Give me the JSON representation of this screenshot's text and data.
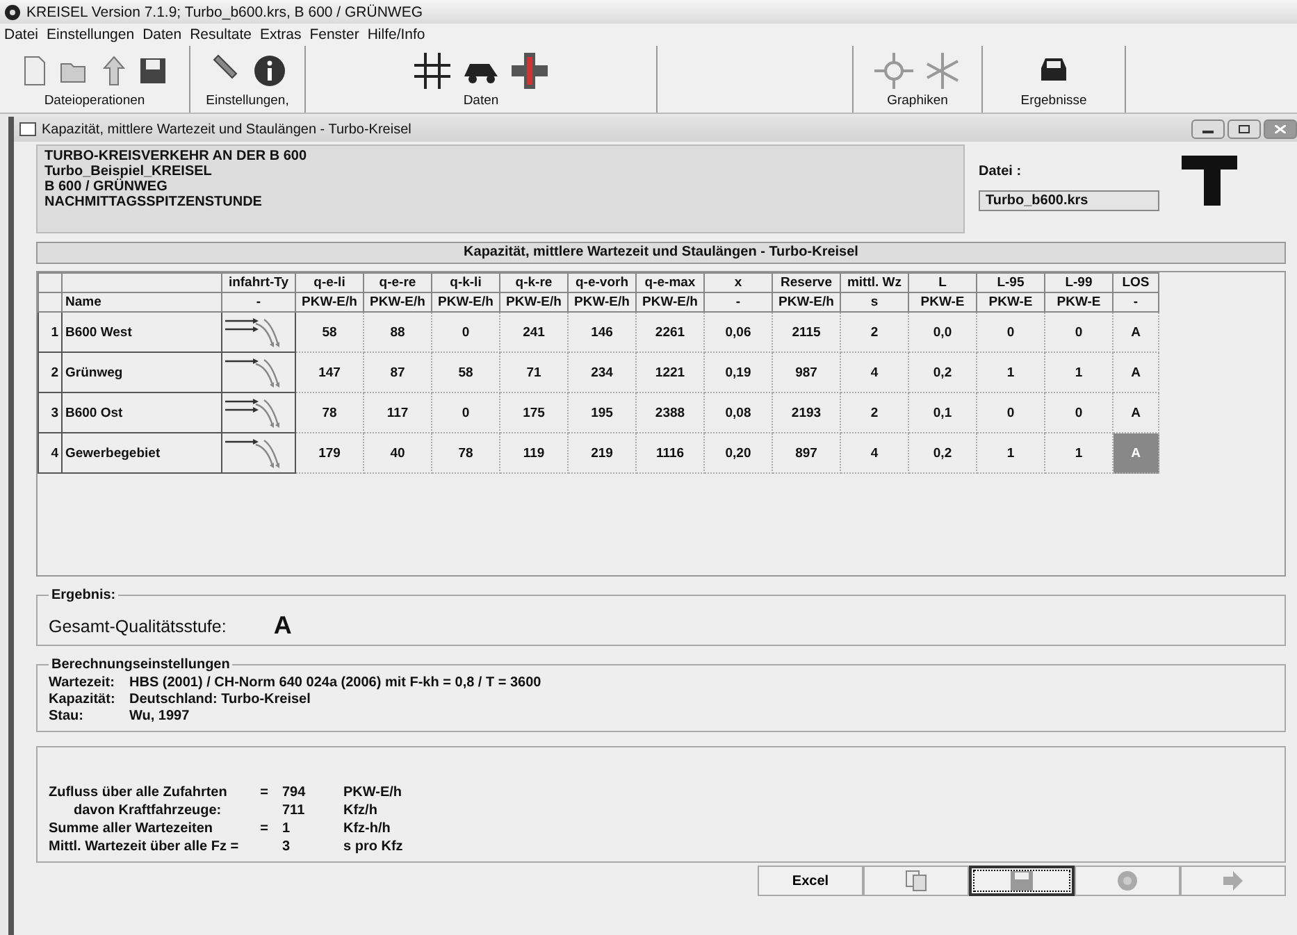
{
  "window": {
    "title": "KREISEL Version 7.1.9;  Turbo_b600.krs,  B 600 / GRÜNWEG"
  },
  "menu": [
    "Datei",
    "Einstellungen",
    "Daten",
    "Resultate",
    "Extras",
    "Fenster",
    "Hilfe/Info"
  ],
  "toolbar": [
    {
      "label": "Dateioperationen"
    },
    {
      "label": "Einstellungen,"
    },
    {
      "label": "Daten"
    },
    {
      "label": "Graphiken"
    },
    {
      "label": "Ergebnisse"
    }
  ],
  "subwindow": {
    "title": "Kapazität, mittlere Wartezeit und Staulängen  -  Turbo-Kreisel"
  },
  "project": [
    "TURBO-KREISVERKEHR AN DER B 600",
    "Turbo_Beispiel_KREISEL",
    "B 600 / GRÜNWEG",
    "NACHMITTAGSSPITZENSTUNDE"
  ],
  "file": {
    "label": "Datei :",
    "value": "Turbo_b600.krs"
  },
  "table": {
    "title": "Kapazität, mittlere Wartezeit und Staulängen   -   Turbo-Kreisel",
    "columns": [
      {
        "header": "infahrt-Ty",
        "unit": "-"
      },
      {
        "header": "q-e-li",
        "unit": "PKW-E/h"
      },
      {
        "header": "q-e-re",
        "unit": "PKW-E/h"
      },
      {
        "header": "q-k-li",
        "unit": "PKW-E/h"
      },
      {
        "header": "q-k-re",
        "unit": "PKW-E/h"
      },
      {
        "header": "q-e-vorh",
        "unit": "PKW-E/h"
      },
      {
        "header": "q-e-max",
        "unit": "PKW-E/h"
      },
      {
        "header": "x",
        "unit": "-"
      },
      {
        "header": "Reserve",
        "unit": "PKW-E/h"
      },
      {
        "header": "mittl. Wz",
        "unit": "s"
      },
      {
        "header": "L",
        "unit": "PKW-E"
      },
      {
        "header": "L-95",
        "unit": "PKW-E"
      },
      {
        "header": "L-99",
        "unit": "PKW-E"
      },
      {
        "header": "LOS",
        "unit": "-"
      }
    ],
    "name_header": "Name",
    "rows": [
      {
        "index": "1",
        "name": "B600 West",
        "kind": "double",
        "values": [
          "58",
          "88",
          "0",
          "241",
          "146",
          "2261",
          "0,06",
          "2115",
          "2",
          "0,0",
          "0",
          "0"
        ],
        "los": "A",
        "selected": false
      },
      {
        "index": "2",
        "name": "Grünweg",
        "kind": "single",
        "values": [
          "147",
          "87",
          "58",
          "71",
          "234",
          "1221",
          "0,19",
          "987",
          "4",
          "0,2",
          "1",
          "1"
        ],
        "los": "A",
        "selected": false
      },
      {
        "index": "3",
        "name": "B600 Ost",
        "kind": "double",
        "values": [
          "78",
          "117",
          "0",
          "175",
          "195",
          "2388",
          "0,08",
          "2193",
          "2",
          "0,1",
          "0",
          "0"
        ],
        "los": "A",
        "selected": false
      },
      {
        "index": "4",
        "name": "Gewerbegebiet",
        "kind": "single",
        "values": [
          "179",
          "40",
          "78",
          "119",
          "219",
          "1116",
          "0,20",
          "897",
          "4",
          "0,2",
          "1",
          "1"
        ],
        "los": "A",
        "selected": true
      }
    ]
  },
  "result": {
    "legend": "Ergebnis:",
    "label": "Gesamt-Qualitätsstufe:",
    "value": "A"
  },
  "settings": {
    "legend": "Berechnungseinstellungen",
    "lines": [
      {
        "label": "Wartezeit:",
        "value": "HBS (2001) / CH-Norm 640 024a (2006) mit F-kh = 0,8 / T = 3600"
      },
      {
        "label": "Kapazität:",
        "value": "Deutschland: Turbo-Kreisel"
      },
      {
        "label": "Stau:",
        "value": "Wu, 1997"
      }
    ]
  },
  "summary": [
    {
      "label": "Zufluss über alle Zufahrten",
      "sign": "=",
      "value": "794",
      "unit": "PKW-E/h",
      "kind": "main"
    },
    {
      "label": "davon Kraftfahrzeuge:",
      "value": "711",
      "unit": "Kfz/h",
      "kind": "sub"
    },
    {
      "label": "Summe aller Wartezeiten",
      "sign": "=",
      "value": "1",
      "unit": "Kfz-h/h",
      "kind": "main"
    },
    {
      "label": "Mittl. Wartezeit über alle Fz =",
      "value": "3",
      "unit": "s pro Kfz",
      "kind": "main"
    }
  ],
  "buttons": [
    {
      "kind": "text",
      "label": "Excel",
      "focused": false
    },
    {
      "kind": "copy",
      "focused": false
    },
    {
      "kind": "save",
      "focused": true
    },
    {
      "kind": "help",
      "focused": false
    },
    {
      "kind": "next",
      "focused": false
    }
  ]
}
